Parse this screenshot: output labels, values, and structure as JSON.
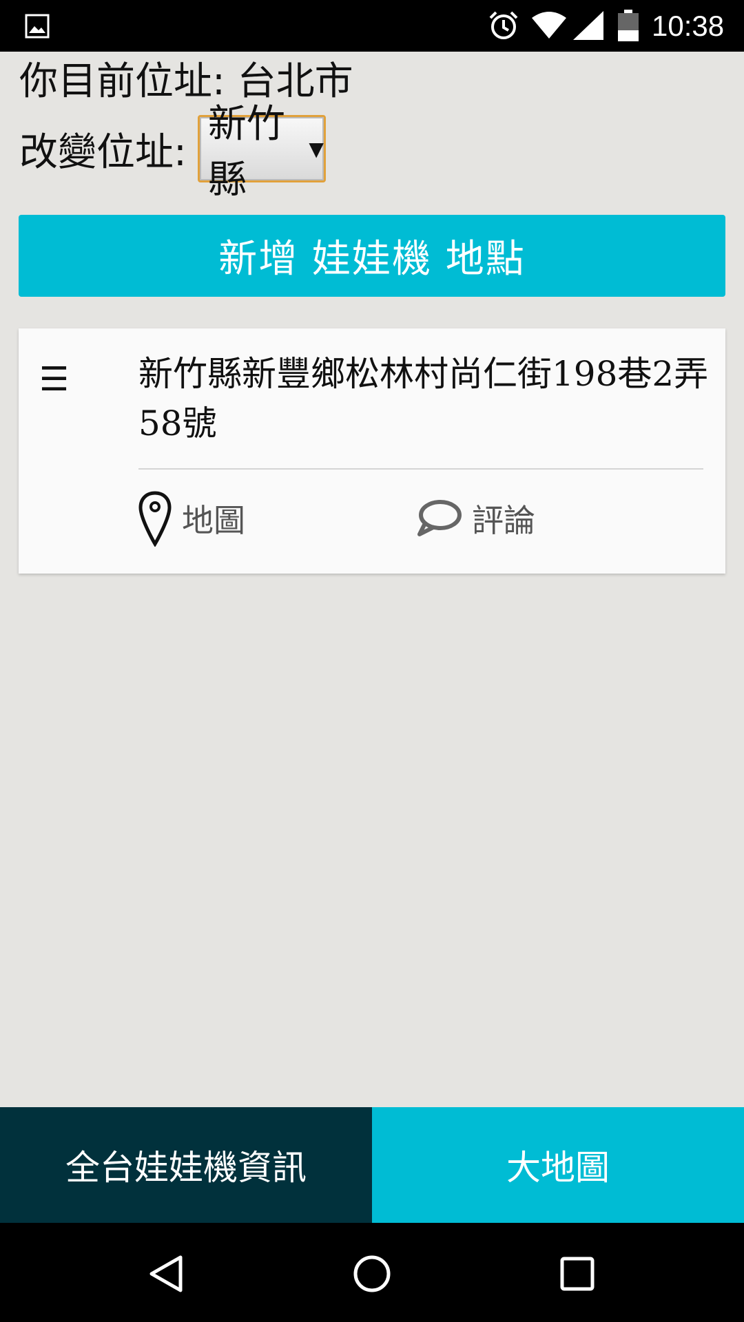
{
  "status_bar": {
    "time": "10:38",
    "icons": [
      "gallery-icon",
      "alarm-icon",
      "wifi-icon",
      "signal-icon",
      "battery-icon"
    ]
  },
  "location": {
    "current_label": "你目前位址: 台北市",
    "change_label": "改變位址:",
    "selected_city": "新竹縣",
    "caret": "▼"
  },
  "add_button": {
    "label": "新增 娃娃機 地點"
  },
  "list": {
    "items": [
      {
        "menu_icon": "☰",
        "address": "新竹縣新豐鄉松林村尚仁街198巷2弄58號",
        "map_label": "地圖",
        "comment_label": "評論"
      }
    ]
  },
  "bottom_tabs": {
    "info_label": "全台娃娃機資訊",
    "map_label": "大地圖"
  },
  "colors": {
    "accent": "#00bcd4",
    "dark_tab": "#01313c",
    "background": "#e5e4e1",
    "select_border": "#e1a13b"
  }
}
